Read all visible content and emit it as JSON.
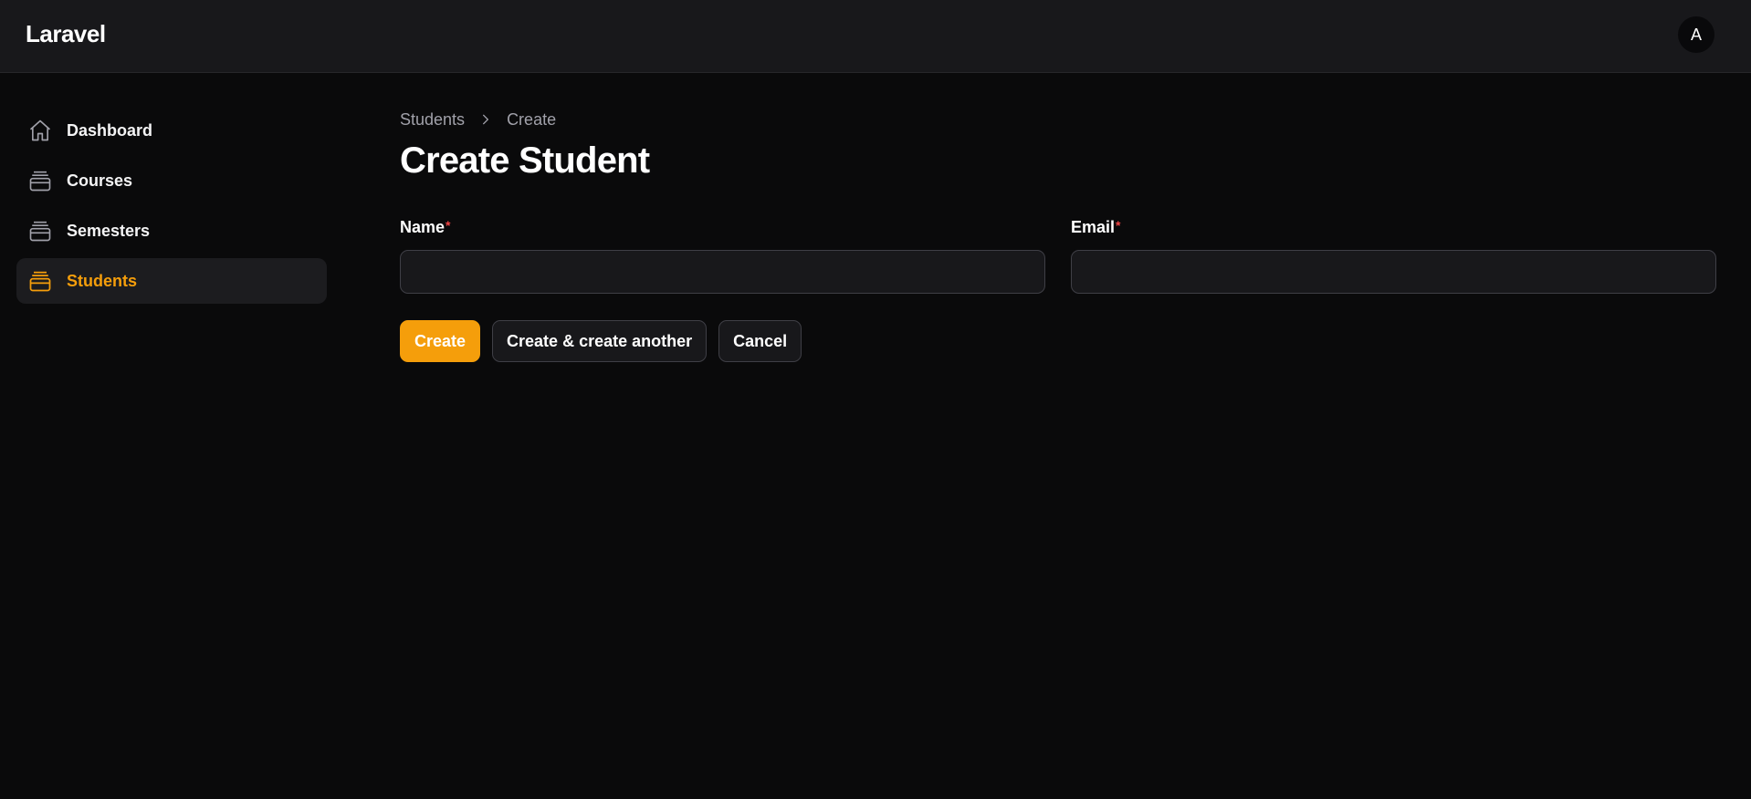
{
  "app": {
    "brand": "Laravel"
  },
  "user": {
    "avatar_initial": "A"
  },
  "sidebar": {
    "items": [
      {
        "label": "Dashboard",
        "icon": "home-icon"
      },
      {
        "label": "Courses",
        "icon": "stack-icon"
      },
      {
        "label": "Semesters",
        "icon": "stack-icon"
      },
      {
        "label": "Students",
        "icon": "stack-icon",
        "active": true
      }
    ]
  },
  "breadcrumb": {
    "items": [
      "Students",
      "Create"
    ],
    "separator_icon": "chevron-right-icon"
  },
  "page": {
    "title": "Create Student"
  },
  "form": {
    "name": {
      "label": "Name",
      "required_mark": "*",
      "value": "",
      "placeholder": ""
    },
    "email": {
      "label": "Email",
      "required_mark": "*",
      "value": "",
      "placeholder": ""
    }
  },
  "actions": {
    "create": "Create",
    "create_another": "Create & create another",
    "cancel": "Cancel"
  },
  "colors": {
    "accent": "#f59e0b",
    "background": "#0a0a0b",
    "surface": "#18181b",
    "required": "#ef4444"
  }
}
